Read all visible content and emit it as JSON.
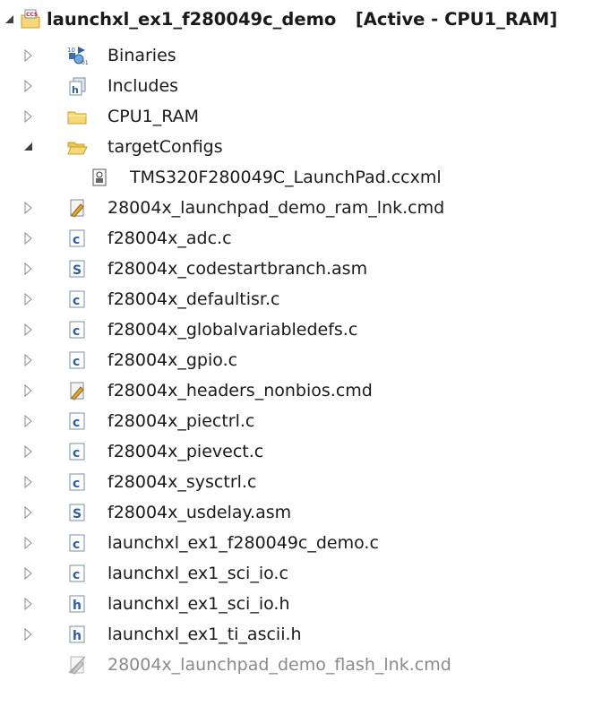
{
  "project_explorer": {
    "project": {
      "name": "launchxl_ex1_f280049c_demo",
      "config": "[Active - CPU1_RAM]",
      "icon": "ccs-project-icon",
      "expanded": true
    },
    "items": [
      {
        "label": "Binaries",
        "icon": "binaries-icon",
        "toggle": "collapsed",
        "level": 1
      },
      {
        "label": "Includes",
        "icon": "includes-icon",
        "toggle": "collapsed",
        "level": 1
      },
      {
        "label": "CPU1_RAM",
        "icon": "folder-icon",
        "toggle": "collapsed",
        "level": 1
      },
      {
        "label": "targetConfigs",
        "icon": "folder-open-icon",
        "toggle": "expanded",
        "level": 1
      },
      {
        "label": "TMS320F280049C_LaunchPad.ccxml",
        "icon": "ccxml-file-icon",
        "toggle": "none",
        "level": 2
      },
      {
        "label": "28004x_launchpad_demo_ram_lnk.cmd",
        "icon": "cmd-file-icon",
        "toggle": "collapsed",
        "level": 1
      },
      {
        "label": "f28004x_adc.c",
        "icon": "c-file-icon",
        "toggle": "collapsed",
        "level": 1
      },
      {
        "label": "f28004x_codestartbranch.asm",
        "icon": "asm-file-icon",
        "toggle": "collapsed",
        "level": 1
      },
      {
        "label": "f28004x_defaultisr.c",
        "icon": "c-file-icon",
        "toggle": "collapsed",
        "level": 1
      },
      {
        "label": "f28004x_globalvariabledefs.c",
        "icon": "c-file-icon",
        "toggle": "collapsed",
        "level": 1
      },
      {
        "label": "f28004x_gpio.c",
        "icon": "c-file-icon",
        "toggle": "collapsed",
        "level": 1
      },
      {
        "label": "f28004x_headers_nonbios.cmd",
        "icon": "cmd-file-icon",
        "toggle": "collapsed",
        "level": 1
      },
      {
        "label": "f28004x_piectrl.c",
        "icon": "c-file-icon",
        "toggle": "collapsed",
        "level": 1
      },
      {
        "label": "f28004x_pievect.c",
        "icon": "c-file-icon",
        "toggle": "collapsed",
        "level": 1
      },
      {
        "label": "f28004x_sysctrl.c",
        "icon": "c-file-icon",
        "toggle": "collapsed",
        "level": 1
      },
      {
        "label": "f28004x_usdelay.asm",
        "icon": "asm-file-icon",
        "toggle": "collapsed",
        "level": 1
      },
      {
        "label": "launchxl_ex1_f280049c_demo.c",
        "icon": "c-file-icon",
        "toggle": "collapsed",
        "level": 1
      },
      {
        "label": "launchxl_ex1_sci_io.c",
        "icon": "c-file-icon",
        "toggle": "collapsed",
        "level": 1
      },
      {
        "label": "launchxl_ex1_sci_io.h",
        "icon": "h-file-icon",
        "toggle": "collapsed",
        "level": 1
      },
      {
        "label": "launchxl_ex1_ti_ascii.h",
        "icon": "h-file-icon",
        "toggle": "collapsed",
        "level": 1
      },
      {
        "label": "28004x_launchpad_demo_flash_lnk.cmd",
        "icon": "cmd-file-excluded-icon",
        "toggle": "none",
        "level": 1,
        "excluded": true
      }
    ]
  },
  "colors": {
    "text": "#1a1a1a",
    "excluded_text": "#8a8a8a",
    "toggle_gray": "#8c8c8c",
    "toggle_dark": "#404040",
    "folder_fill": "#f6d77a",
    "folder_stroke": "#c9a21f",
    "file_border": "#7a8fa6",
    "c_letter": "#2a5ea8",
    "h_letter": "#2a5ea8",
    "s_letter": "#2a5ea8"
  }
}
